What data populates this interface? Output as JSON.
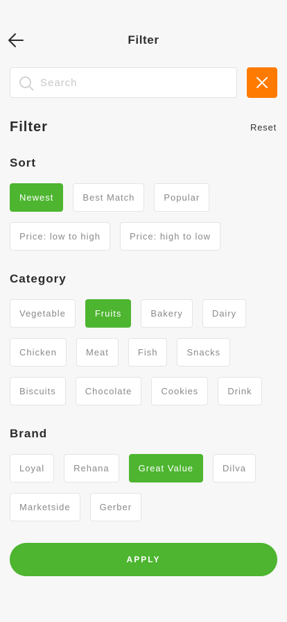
{
  "header": {
    "title": "Filter",
    "back_icon": "arrow-left-icon"
  },
  "search": {
    "placeholder": "Search",
    "value": "",
    "icon": "search-icon",
    "clear_icon": "close-icon",
    "clear_color": "#ff7a00"
  },
  "filter": {
    "title": "Filter",
    "reset_label": "Reset"
  },
  "sort": {
    "title": "Sort",
    "options": [
      {
        "label": "Newest",
        "selected": true
      },
      {
        "label": "Best Match",
        "selected": false
      },
      {
        "label": "Popular",
        "selected": false
      },
      {
        "label": "Price: low to high",
        "selected": false
      },
      {
        "label": "Price: high to low",
        "selected": false
      }
    ]
  },
  "category": {
    "title": "Category",
    "options": [
      {
        "label": "Vegetable",
        "selected": false
      },
      {
        "label": "Fruits",
        "selected": true
      },
      {
        "label": "Bakery",
        "selected": false
      },
      {
        "label": "Dairy",
        "selected": false
      },
      {
        "label": "Chicken",
        "selected": false
      },
      {
        "label": "Meat",
        "selected": false
      },
      {
        "label": "Fish",
        "selected": false
      },
      {
        "label": "Snacks",
        "selected": false
      },
      {
        "label": "Biscuits",
        "selected": false
      },
      {
        "label": "Chocolate",
        "selected": false
      },
      {
        "label": "Cookies",
        "selected": false
      },
      {
        "label": "Drink",
        "selected": false
      }
    ]
  },
  "brand": {
    "title": "Brand",
    "options": [
      {
        "label": "Loyal",
        "selected": false
      },
      {
        "label": "Rehana",
        "selected": false
      },
      {
        "label": "Great Value",
        "selected": true
      },
      {
        "label": "Dilva",
        "selected": false
      },
      {
        "label": "Marketside",
        "selected": false
      },
      {
        "label": "Gerber",
        "selected": false
      }
    ]
  },
  "apply": {
    "label": "APPLY"
  },
  "colors": {
    "accent": "#4db530",
    "clear_button": "#ff7a00",
    "background": "#f7f7f7"
  }
}
